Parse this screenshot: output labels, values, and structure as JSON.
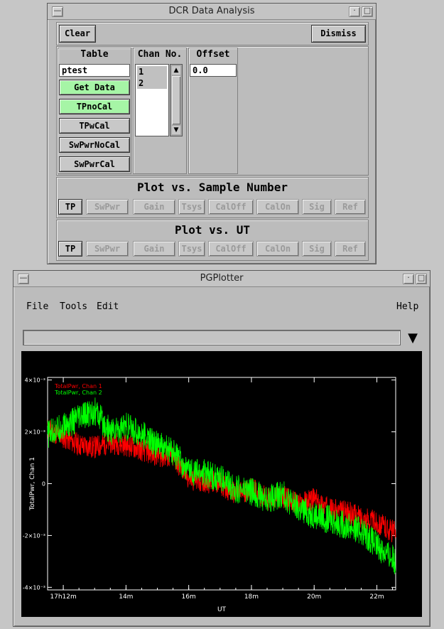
{
  "dcr_window": {
    "title": "DCR Data Analysis",
    "clear_label": "Clear",
    "dismiss_label": "Dismiss",
    "table": {
      "header": "Table",
      "value": "ptest",
      "buttons": [
        "Get Data",
        "TPnoCal",
        "TPwCal",
        "SwPwrNoCal",
        "SwPwrCal"
      ]
    },
    "chan": {
      "header": "Chan No.",
      "items": [
        "1",
        "2"
      ]
    },
    "offset": {
      "header": "Offset",
      "value": "0.0"
    },
    "plot_sample": {
      "label": "Plot vs. Sample Number",
      "buttons": [
        "TP",
        "SwPwr",
        "Gain",
        "Tsys",
        "CalOff",
        "CalOn",
        "Sig",
        "Ref"
      ]
    },
    "plot_ut": {
      "label": "Plot vs. UT",
      "buttons": [
        "TP",
        "SwPwr",
        "Gain",
        "Tsys",
        "CalOff",
        "CalOn",
        "Sig",
        "Ref"
      ]
    }
  },
  "pg_window": {
    "title": "PGPlotter",
    "menus": [
      "File",
      "Tools",
      "Edit"
    ],
    "help": "Help",
    "dropdown_value": ""
  },
  "chart_data": {
    "type": "line",
    "xlabel": "UT",
    "ylabel": "TotalPwr, Chan 1",
    "x_ticks": [
      "17h12m",
      "14m",
      "16m",
      "18m",
      "20m",
      "22m"
    ],
    "y_ticks": [
      "4×10⁻³",
      "2×10⁻³",
      "0",
      "-2×10⁻³",
      "-4×10⁻³"
    ],
    "xlim": [
      11.5,
      22.6
    ],
    "ylim": [
      -0.0041,
      0.0041
    ],
    "series": [
      {
        "name": "TotalPwr, Chan 1",
        "color": "#ff0000",
        "x": [
          11.5,
          12,
          12.5,
          13,
          13.5,
          14,
          14.5,
          15,
          15.5,
          16,
          16.5,
          17,
          17.5,
          18,
          18.5,
          19,
          19.5,
          20,
          20.5,
          21,
          21.5,
          22,
          22.6
        ],
        "y": [
          0.0021,
          0.0018,
          0.0015,
          0.0014,
          0.0016,
          0.0015,
          0.0013,
          0.0011,
          0.001,
          0.0002,
          0.0001,
          0.0,
          -0.0004,
          -0.0002,
          -0.0006,
          -0.0005,
          -0.0008,
          -0.0006,
          -0.001,
          -0.0011,
          -0.0013,
          -0.0015,
          -0.0019
        ]
      },
      {
        "name": "TotalPwr, Chan 2",
        "color": "#00ff00",
        "x": [
          11.5,
          12,
          12.5,
          13,
          13.5,
          14,
          14.5,
          15,
          15.5,
          16,
          16.5,
          17,
          17.5,
          18,
          18.5,
          19,
          19.5,
          20,
          20.5,
          21,
          21.5,
          22,
          22.6
        ],
        "y": [
          0.0019,
          0.0022,
          0.0025,
          0.0028,
          0.002,
          0.0022,
          0.0019,
          0.0015,
          0.0012,
          0.0005,
          0.0004,
          0.0002,
          -0.0002,
          -0.0003,
          -0.0006,
          -0.0004,
          -0.001,
          -0.0012,
          -0.0014,
          -0.0016,
          -0.0018,
          -0.0024,
          -0.003
        ]
      }
    ],
    "legend_position": "top-left"
  }
}
